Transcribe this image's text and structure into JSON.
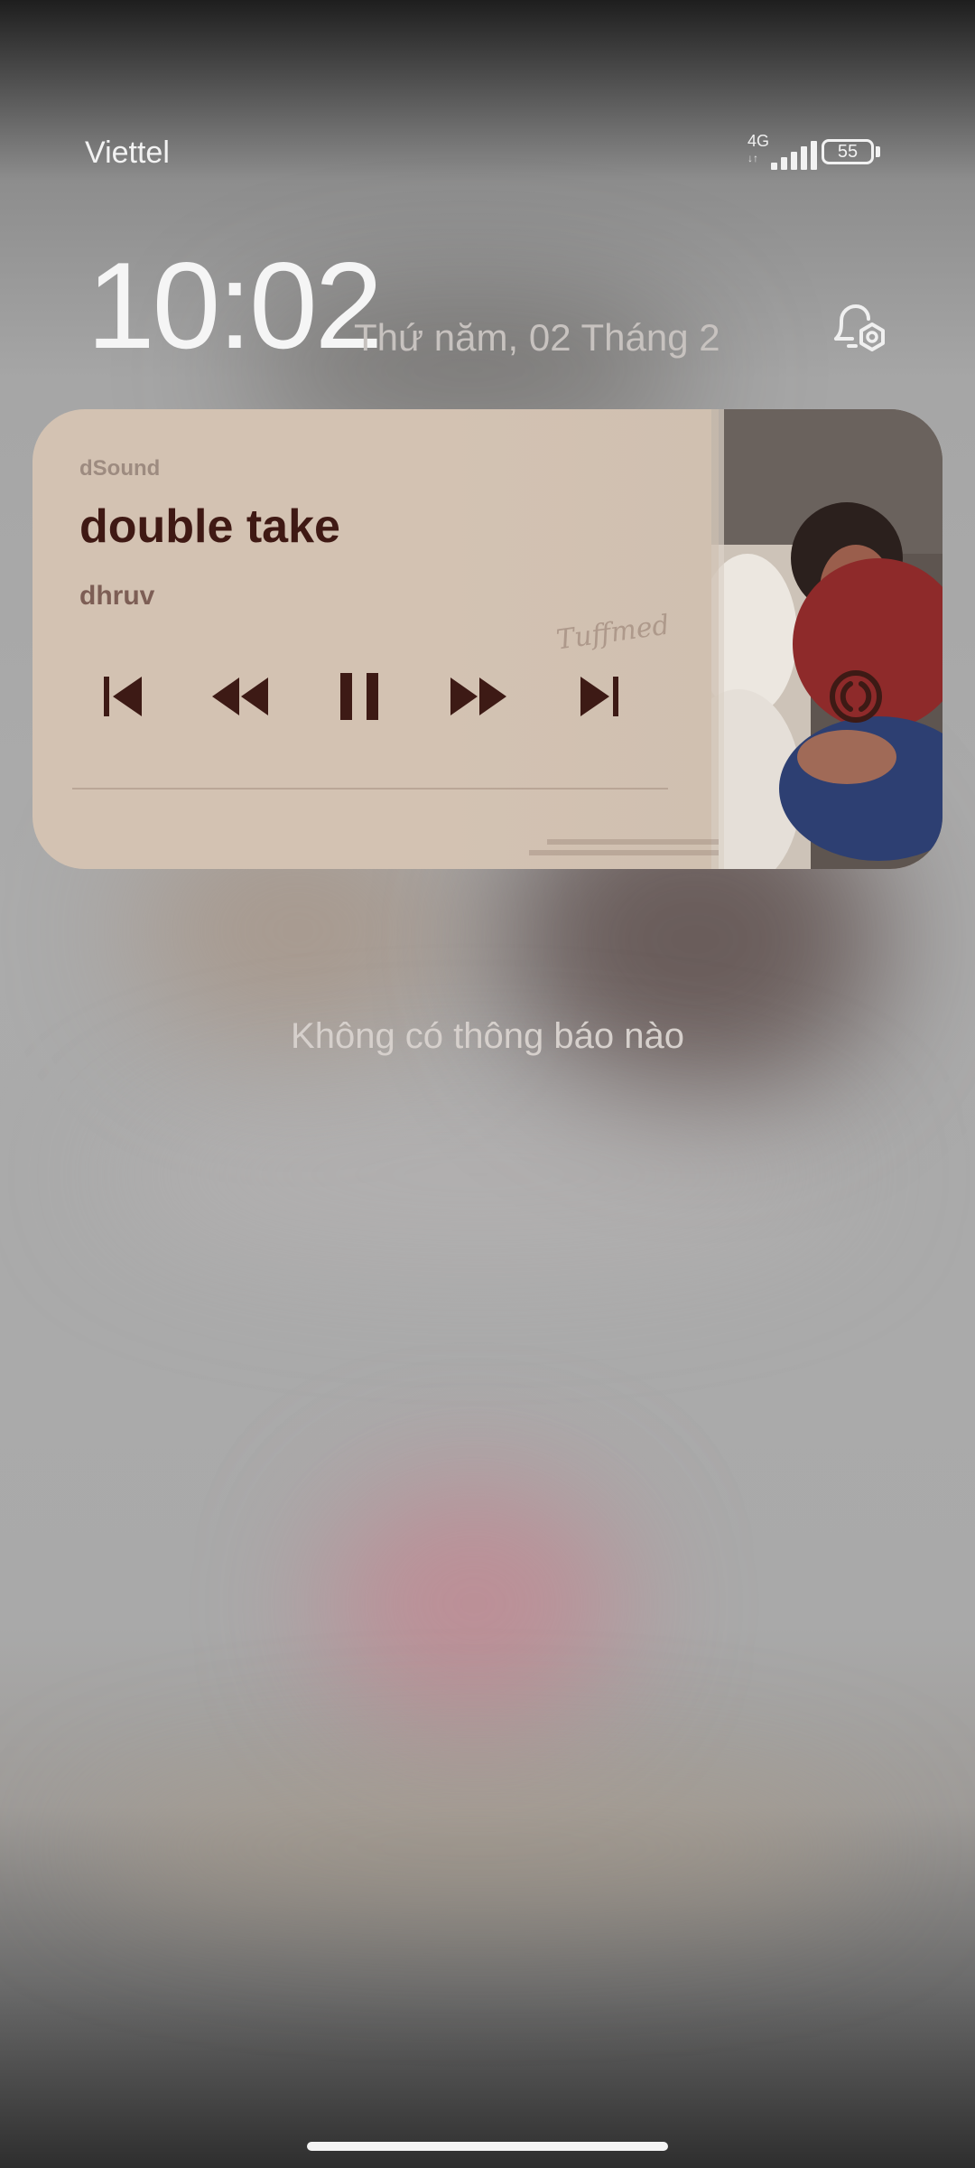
{
  "status_bar": {
    "carrier": "Viettel",
    "network_type": "4G",
    "network_arrows": "↓↑",
    "signal_icon": "signal-bars-icon",
    "battery_level": "55"
  },
  "lockscreen": {
    "time": "10:02",
    "date": "Thứ năm, 02 Tháng 2",
    "alarm_icon": "alarm-settings-icon"
  },
  "media_card": {
    "app_name": "dSound",
    "track_title": "double take",
    "artist": "dhruv",
    "progress_fraction": 0,
    "controls": [
      {
        "name": "previous-track",
        "icon": "skip-previous-icon"
      },
      {
        "name": "rewind",
        "icon": "rewind-icon"
      },
      {
        "name": "pause",
        "icon": "pause-icon"
      },
      {
        "name": "fast-forward",
        "icon": "fast-forward-icon"
      },
      {
        "name": "next-track",
        "icon": "skip-next-icon"
      }
    ],
    "output_icon": "broadcast-icon",
    "album_art_text": "Tuffmed",
    "colors": {
      "card_bg": "#d3c2b2",
      "title": "#3f1914",
      "controls": "#3d1a15",
      "artist": "#7d5e55",
      "app_name": "#9d8b80"
    }
  },
  "notifications": {
    "empty_text": "Không có thông báo nào"
  }
}
